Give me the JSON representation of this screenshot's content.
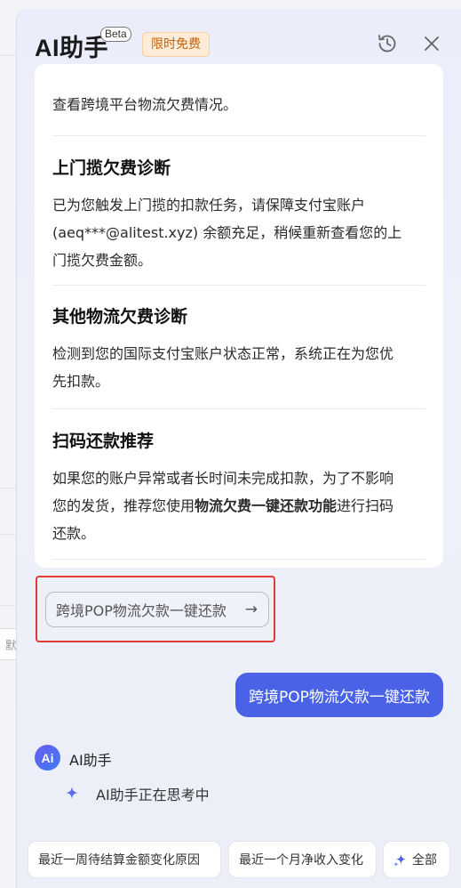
{
  "header": {
    "title": "AI助手",
    "beta": "Beta",
    "free_badge": "限时免费"
  },
  "card": {
    "intro_tail": "查看跨境平台物流欠费情况。",
    "sections": [
      {
        "title": "上门揽欠费诊断",
        "lines": [
          "已为您触发上门揽的扣款任务，请保障支付宝账户",
          "(aeq***@alitest.xyz) 余额充足，稍候重新查看您的上",
          "门揽欠费金额。"
        ]
      },
      {
        "title": "其他物流欠费诊断",
        "lines": [
          "检测到您的国际支付宝账户状态正常，系统正在为您优",
          "先扣款。"
        ]
      },
      {
        "title": "扫码还款推荐",
        "line1": "如果您的账户异常或者长时间未完成扣款，为了不影响",
        "line2_prefix": "您的发货，推荐您使用",
        "line2_bold": "物流欠费一键还款功能",
        "line2_suffix": "进行扫码",
        "line3": "还款。"
      }
    ]
  },
  "suggestion": {
    "label": "跨境POP物流欠款一键还款",
    "arrow": "→"
  },
  "user_message": "跨境POP物流欠款一键还款",
  "assistant": {
    "avatar_text": "Ai",
    "name": "AI助手",
    "thinking": "AI助手正在思考中"
  },
  "bottom_chips": [
    "最近一周待结算金额变化原因",
    "最近一个月净收入变化",
    "全部"
  ],
  "background": {
    "partial_field_char": "默"
  },
  "colors": {
    "accent": "#4a63e6",
    "badge_text": "#c2620e",
    "badge_bg": "#fdebd5",
    "highlight_border": "#e03a3a"
  }
}
